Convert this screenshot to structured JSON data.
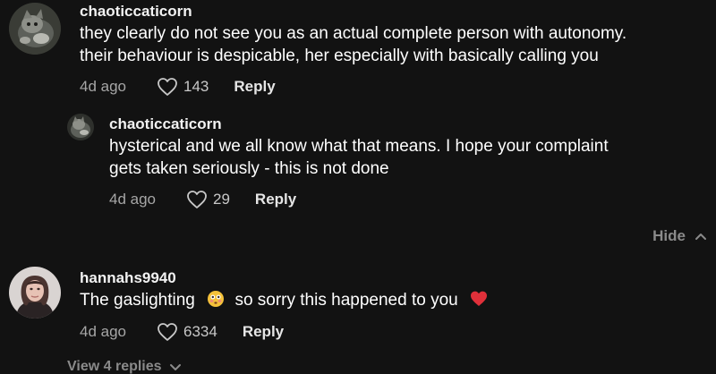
{
  "comments": [
    {
      "username": "chaoticcaticorn",
      "lines": [
        "they clearly do not see you as an actual complete person with autonomy.",
        "their behaviour is despicable, her especially with basically calling you"
      ],
      "time": "4d ago",
      "likes": "143",
      "reply_label": "Reply",
      "avatar_icon": "cat-avatar-icon",
      "replies": [
        {
          "username": "chaoticcaticorn",
          "lines": [
            "hysterical and we all know what that means. I hope your complaint",
            "gets taken seriously - this is not done"
          ],
          "time": "4d ago",
          "likes": "29",
          "reply_label": "Reply",
          "avatar_icon": "cat-avatar-icon"
        }
      ],
      "hide_label": "Hide"
    },
    {
      "username": "hannahs9940",
      "text_before_emoji": "The gaslighting",
      "text_after_emoji": "so sorry this happened to you",
      "emojis": [
        "flushed-face-emoji",
        "red-heart-emoji"
      ],
      "time": "4d ago",
      "likes": "6334",
      "reply_label": "Reply",
      "avatar_icon": "person-avatar-icon",
      "view_replies_label": "View 4 replies"
    }
  ],
  "colors": {
    "background": "#121212",
    "text_primary": "#ffffff",
    "text_secondary": "#a6a6a6",
    "link_muted": "#8a8a8a",
    "heart_red": "#e0303a",
    "emoji_yellow": "#f5c23a"
  }
}
